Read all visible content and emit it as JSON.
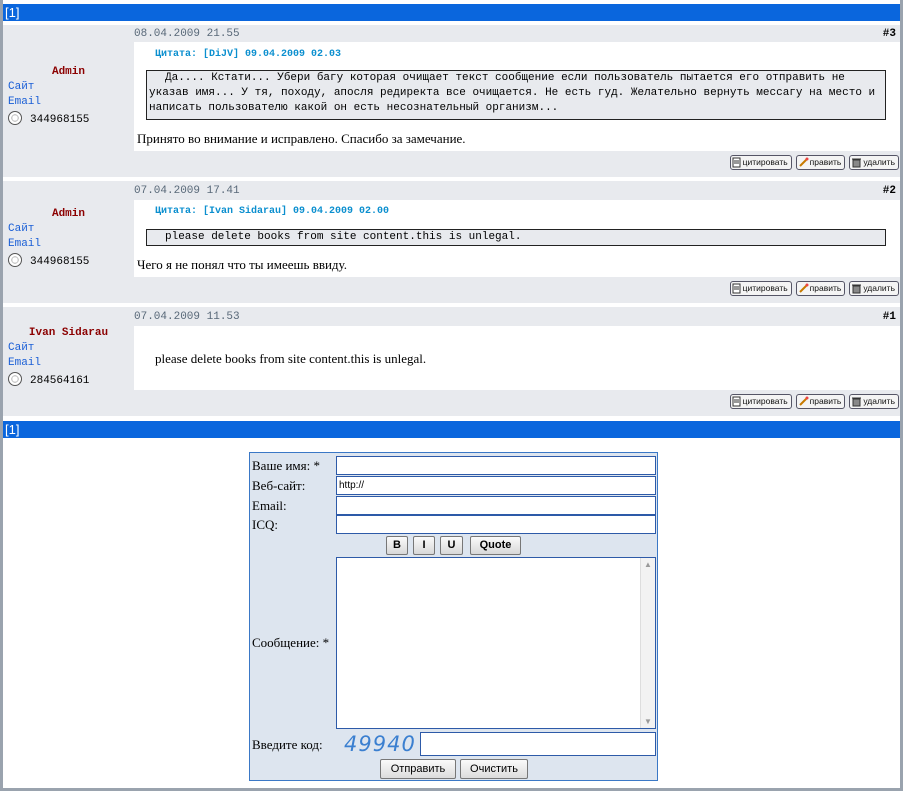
{
  "pager": {
    "top_label": "[1]",
    "bottom_label": "[1]"
  },
  "posts": [
    {
      "author": "Admin",
      "site_label": "Сайт",
      "email_label": "Email",
      "icq": "344968155",
      "date": "08.04.2009 21.55",
      "number": "#3",
      "quote_header": "Цитата: [DiJV] 09.04.2009 02.03",
      "quote_text": "Да.... Кстати... Убери багу которая очищает текст сообщение если пользователь пытается его отправить не указав имя... У тя, походу, апосля редиректа все очищается. Не есть гуд. Желательно вернуть мессагу на место и написать пользователю какой он есть несознательный организм...",
      "text": "Принято во внимание и исправлено. Спасибо за замечание."
    },
    {
      "author": "Admin",
      "site_label": "Сайт",
      "email_label": "Email",
      "icq": "344968155",
      "date": "07.04.2009 17.41",
      "number": "#2",
      "quote_header": "Цитата: [Ivan Sidarau] 09.04.2009 02.00",
      "quote_text": "please delete books from site content.this is unlegal.",
      "text": "Чего я не понял что ты имеешь ввиду."
    },
    {
      "author": "Ivan Sidarau",
      "site_label": "Сайт",
      "email_label": "Email",
      "icq": "284564161",
      "date": "07.04.2009 11.53",
      "number": "#1",
      "text": "please delete books from site content.this is unlegal."
    }
  ],
  "post_buttons": {
    "quote": "цитировать",
    "edit": "править",
    "delete": "удалить"
  },
  "form": {
    "name_label": "Ваше имя: *",
    "name_value": "",
    "website_label": "Веб-сайт:",
    "website_value": "http://",
    "email_label": "Email:",
    "email_value": "",
    "icq_label": "ICQ:",
    "icq_value": "",
    "format_buttons": {
      "bold": "B",
      "italic": "I",
      "underline": "U",
      "quote": "Quote"
    },
    "message_label": "Сообщение: *",
    "message_value": "",
    "captcha_label": "Введите код:",
    "captcha_code": "49940",
    "captcha_value": "",
    "submit_label": "Отправить",
    "clear_label": "Очистить"
  },
  "colors": {
    "pager_bar": "#0a66dd",
    "author": "#8b0000",
    "link": "#1a5fd6",
    "quote_header": "#0b8fcf",
    "post_bg": "#e8eaee",
    "form_bg": "#dde5ef"
  }
}
